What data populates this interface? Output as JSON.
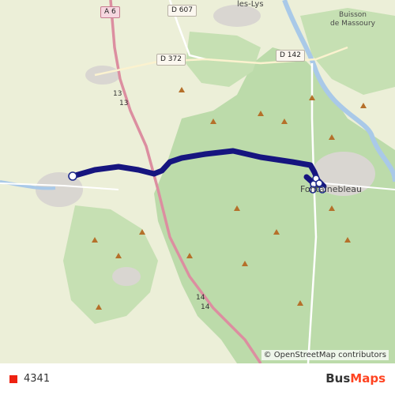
{
  "map": {
    "road_labels": {
      "a6": "A 6",
      "d607": "D 607",
      "d372": "D 372",
      "d142": "D 142",
      "r13a": "13",
      "r13b": "13",
      "r14a": "14",
      "r14b": "14"
    },
    "places": {
      "les_lys": "les-Lys",
      "fontainebleau": "Fontainebleau",
      "buisson_line1": "Buisson",
      "buisson_line2": "de Massoury"
    },
    "copyright": "© OpenStreetMap contributors",
    "colors": {
      "route": "#16157f",
      "forest": "#bcdbaa",
      "farmland": "#ecefd8",
      "urban": "#d9d6d1",
      "water": "#a9c9e8",
      "motorway": "#dc8ea0"
    }
  },
  "footer": {
    "route_number": "4341",
    "route_color": "#ee2211",
    "brand_part1": "Bus",
    "brand_part2": "Maps"
  }
}
